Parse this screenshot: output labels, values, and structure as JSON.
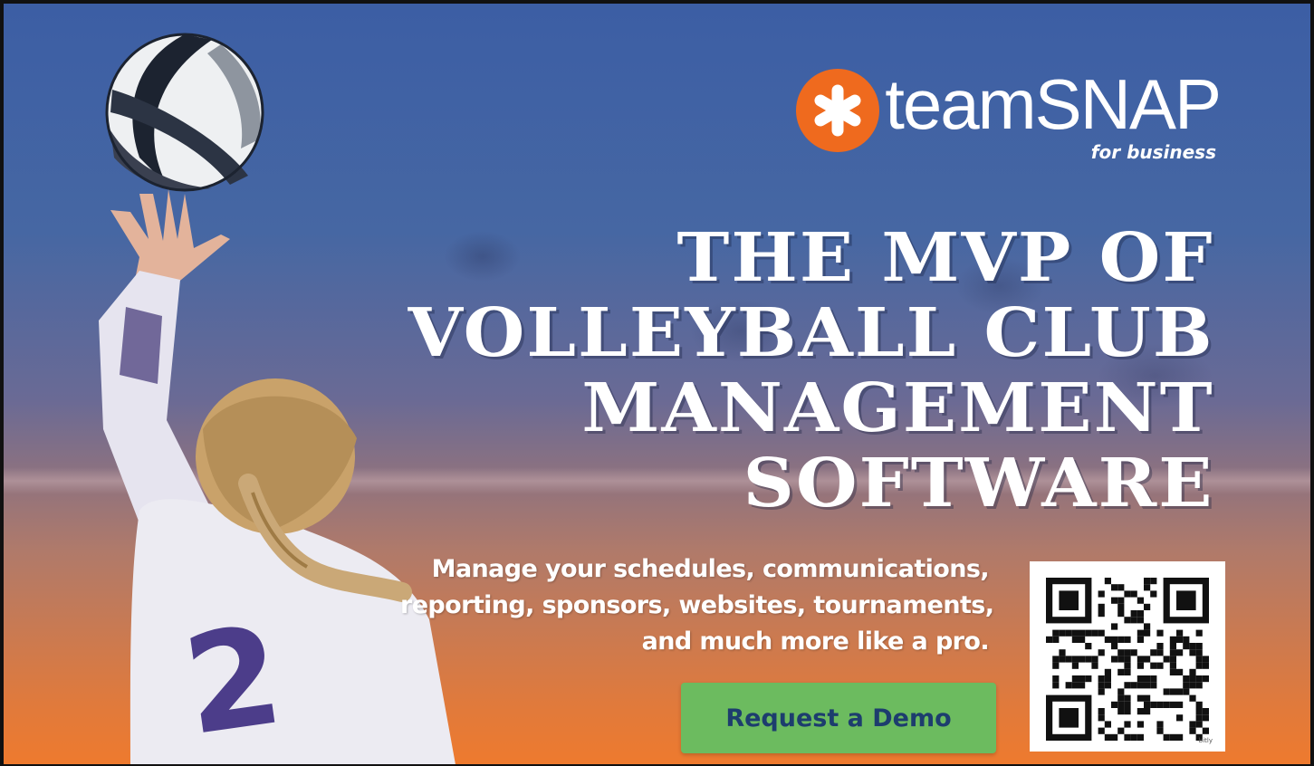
{
  "brand": {
    "logo_word": "teamSNAP",
    "logo_sub": "for business",
    "logo_color": "#ef6a1e"
  },
  "headline": {
    "lines": [
      "THE MVP OF",
      "VOLLEYBALL CLUB",
      "MANAGEMENT",
      "SOFTWARE"
    ]
  },
  "description": {
    "lines": [
      "Manage your schedules, communications,",
      "reporting, sponsors, websites, tournaments,",
      "and much more like a pro."
    ]
  },
  "cta": {
    "label": "Request a Demo",
    "color": "#6cbb5f"
  },
  "qr": {
    "tag": "bitly"
  },
  "player": {
    "jersey_number": "2"
  }
}
